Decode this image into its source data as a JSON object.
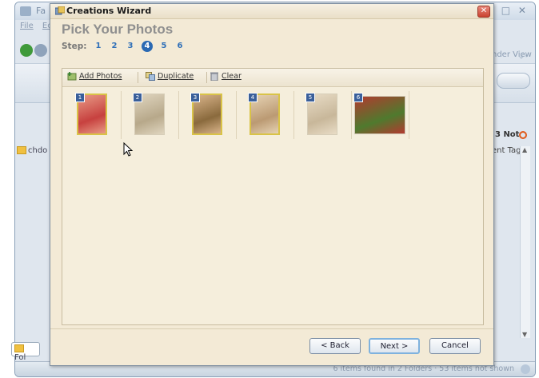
{
  "background_app": {
    "title_fragment": "Fa",
    "menu": [
      "File",
      "Ec"
    ],
    "right_label": "nder View",
    "not_label": "3 Not",
    "column_tag": "ent Tag",
    "left_folder_label": "chdo",
    "folder_button_label": "Fol",
    "status_text": "6 items found in 2 Folders  ·  53 items not shown"
  },
  "wizard": {
    "title": "Creations Wizard",
    "heading": "Pick Your Photos",
    "step_label": "Step:",
    "steps": [
      "1",
      "2",
      "3",
      "4",
      "5",
      "6"
    ],
    "current_step": 4,
    "toolbar": {
      "add_photos": "Add Photos",
      "duplicate": "Duplicate",
      "clear": "Clear"
    },
    "photos": [
      {
        "number": "1",
        "color": "#c7413f",
        "accent": "#e89b86"
      },
      {
        "number": "2",
        "color": "#b7a88a",
        "accent": "#e0d6c0"
      },
      {
        "number": "3",
        "color": "#8a6a3d",
        "accent": "#d9b48a"
      },
      {
        "number": "4",
        "color": "#bb9a73",
        "accent": "#e6d3b4"
      },
      {
        "number": "5",
        "color": "#c8b79a",
        "accent": "#e8dcc6"
      },
      {
        "number": "6",
        "color": "#4f7a2e",
        "accent": "#b33a2f"
      }
    ],
    "buttons": {
      "back": "< Back",
      "next": "Next >",
      "cancel": "Cancel"
    }
  }
}
